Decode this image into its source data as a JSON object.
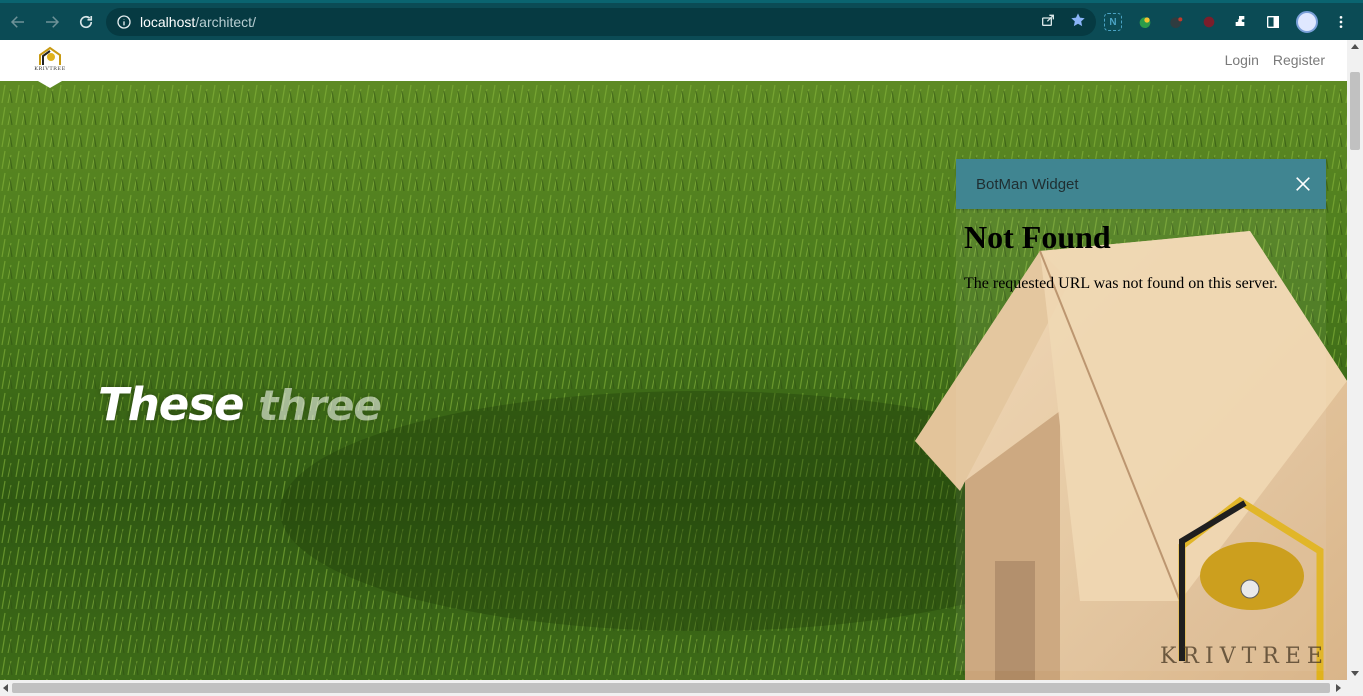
{
  "browser": {
    "url_host": "localhost",
    "url_path": "/architect/",
    "icons": [
      "back-icon",
      "forward-icon",
      "reload-icon",
      "info-icon",
      "share-icon",
      "bookmark-star-icon",
      "extensions-puzzle-icon",
      "side-panel-icon",
      "profile-avatar",
      "menu-dots-icon"
    ],
    "colors": {
      "toolbar": "#0b4b55",
      "omnibox": "#063a42",
      "star": "#8ab4f8"
    }
  },
  "site": {
    "logo_text": "KRIVTREE",
    "nav": {
      "login": "Login",
      "register": "Register"
    }
  },
  "hero": {
    "caption_word1": "These",
    "caption_word2": "three",
    "watermark_text": "KRIVTREE"
  },
  "botman": {
    "title": "BotMan Widget",
    "header_color": "#408591",
    "error_title": "Not Found",
    "error_message": "The requested URL was not found on this server."
  }
}
